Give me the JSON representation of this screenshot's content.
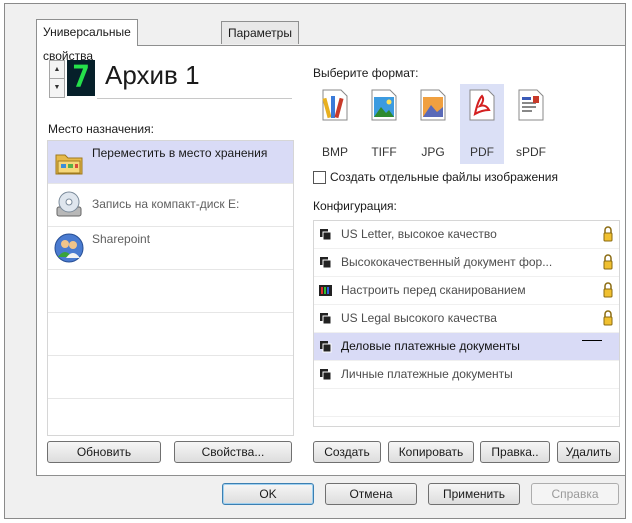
{
  "tabs": [
    "Универсальные свойства",
    "Параметры"
  ],
  "job": {
    "number": "7",
    "title": "Архив 1"
  },
  "destination": {
    "label": "Место назначения:",
    "items": [
      {
        "label": "Переместить в место хранения",
        "icon": "folder-move-icon",
        "selected": true
      },
      {
        "label": "Запись на компакт-диск  E:",
        "icon": "cd-burn-icon",
        "selected": false
      },
      {
        "label": "Sharepoint",
        "icon": "sharepoint-users-icon",
        "selected": false
      }
    ],
    "refresh_button": "Обновить",
    "properties_button": "Свойства..."
  },
  "format": {
    "label": "Выберите формат:",
    "items": [
      {
        "label": "BMP",
        "icon": "bmp-file-icon",
        "selected": false
      },
      {
        "label": "TIFF",
        "icon": "tiff-file-icon",
        "selected": false
      },
      {
        "label": "JPG",
        "icon": "jpg-file-icon",
        "selected": false
      },
      {
        "label": "PDF",
        "icon": "pdf-file-icon",
        "selected": true
      },
      {
        "label": "sPDF",
        "icon": "spdf-file-icon",
        "selected": false
      }
    ],
    "separate_files_label": "Создать отдельные файлы изображения",
    "separate_files_checked": false
  },
  "configuration": {
    "label": "Конфигурация:",
    "items": [
      {
        "label": "US Letter, высокое качество",
        "locked": true,
        "selected": false
      },
      {
        "label": "Высококачественный документ фор...",
        "locked": true,
        "selected": false
      },
      {
        "label": "Настроить перед сканированием",
        "locked": true,
        "selected": false
      },
      {
        "label": "US Legal высокого качества",
        "locked": true,
        "selected": false
      },
      {
        "label": "Деловые платежные документы",
        "locked": false,
        "selected": true
      },
      {
        "label": "Личные платежные документы",
        "locked": false,
        "selected": false
      }
    ],
    "buttons": {
      "create": "Создать",
      "copy": "Копировать",
      "edit": "Правка..",
      "delete": "Удалить"
    }
  },
  "footer": {
    "ok": "OK",
    "cancel": "Отмена",
    "apply": "Применить",
    "help": "Справка"
  },
  "colors": {
    "selection": "#d9dbf6",
    "counter_bg": "#06202a",
    "counter_fg": "#25e14b"
  }
}
